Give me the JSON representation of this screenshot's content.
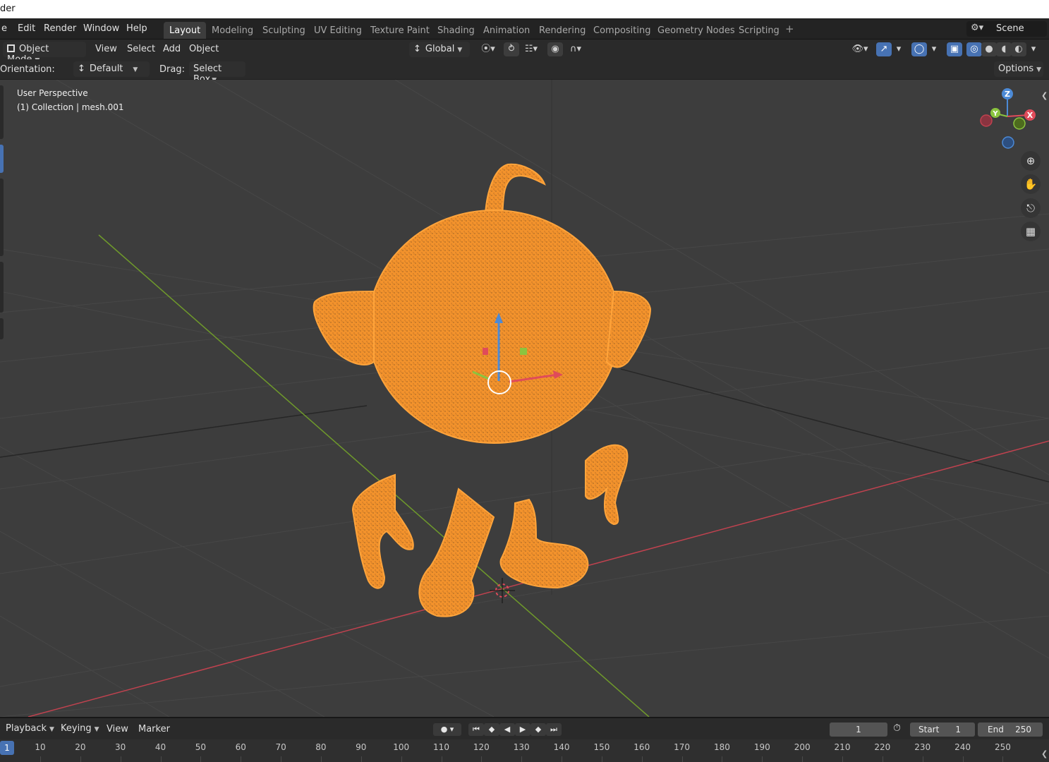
{
  "titlebar": {
    "text": "der"
  },
  "menu": {
    "file": "e",
    "edit": "Edit",
    "render": "Render",
    "window": "Window",
    "help": "Help"
  },
  "workspaces": [
    {
      "label": "Layout"
    },
    {
      "label": "Modeling"
    },
    {
      "label": "Sculpting"
    },
    {
      "label": "UV Editing"
    },
    {
      "label": "Texture Paint"
    },
    {
      "label": "Shading"
    },
    {
      "label": "Animation"
    },
    {
      "label": "Rendering"
    },
    {
      "label": "Compositing"
    },
    {
      "label": "Geometry Nodes"
    },
    {
      "label": "Scripting"
    }
  ],
  "scene": {
    "name": "Scene"
  },
  "header": {
    "mode": "Object Mode",
    "view": "View",
    "select": "Select",
    "add": "Add",
    "object": "Object",
    "transform_orientation": "Global",
    "options": "Options"
  },
  "tool_settings": {
    "orientation_label": "Orientation:",
    "orientation_value": "Default",
    "drag_label": "Drag:",
    "drag_value": "Select Box"
  },
  "viewport": {
    "perspective": "User Perspective",
    "collection": "(1) Collection | mesh.001",
    "gizmo": {
      "x": "X",
      "y": "Y",
      "z": "Z"
    },
    "selection_color": "#f5922a"
  },
  "timeline": {
    "playback": "Playback",
    "keying": "Keying",
    "view": "View",
    "marker": "Marker",
    "current_frame": "1",
    "start_label": "Start",
    "start_value": "1",
    "end_label": "End",
    "end_value": "250",
    "ruler": [
      "10",
      "20",
      "30",
      "40",
      "50",
      "60",
      "70",
      "80",
      "90",
      "100",
      "110",
      "120",
      "130",
      "140",
      "150",
      "160",
      "170",
      "180",
      "190",
      "200",
      "210",
      "220",
      "230",
      "240",
      "250"
    ],
    "ruler_current": "1"
  },
  "colors": {
    "active_blue": "#4772b3",
    "axis_x": "#c0424f",
    "axis_y": "#6f9a2b",
    "axis_z": "#4c8ad6"
  }
}
